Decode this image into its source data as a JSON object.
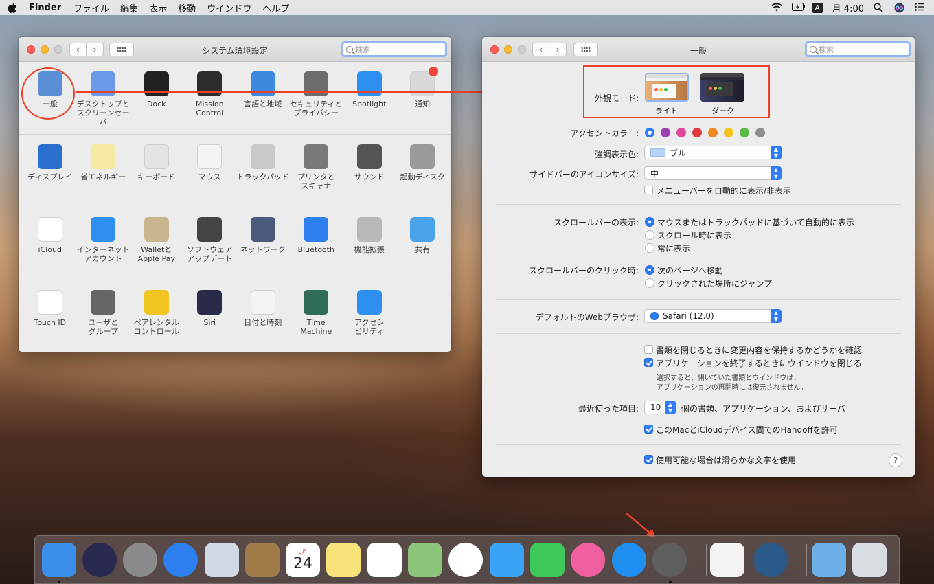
{
  "menubar": {
    "app": "Finder",
    "items": [
      "ファイル",
      "編集",
      "表示",
      "移動",
      "ウインドウ",
      "ヘルプ"
    ],
    "ime": "A",
    "clock": "月 4:00"
  },
  "prefs_window": {
    "title": "システム環境設定",
    "search_placeholder": "検索",
    "rows": [
      [
        {
          "label": "一般",
          "icon": "general-icon",
          "color": "#5a8fd6"
        },
        {
          "label": "デスクトップと\nスクリーンセーバ",
          "icon": "desktop-icon",
          "color": "#6a9ae8"
        },
        {
          "label": "Dock",
          "icon": "dock-icon",
          "color": "#222222"
        },
        {
          "label": "Mission\nControl",
          "icon": "mission-control-icon",
          "color": "#2c2c2c"
        },
        {
          "label": "言語と地域",
          "icon": "language-icon",
          "color": "#3c8ae0"
        },
        {
          "label": "セキュリティと\nプライバシー",
          "icon": "security-icon",
          "color": "#6c6c6c"
        },
        {
          "label": "Spotlight",
          "icon": "spotlight-icon",
          "color": "#2d8ff0"
        },
        {
          "label": "通知",
          "icon": "notifications-icon",
          "color": "#d8d8d8"
        }
      ],
      [
        {
          "label": "ディスプレイ",
          "icon": "display-icon",
          "color": "#2a6fcf"
        },
        {
          "label": "省エネルギー",
          "icon": "energy-icon",
          "color": "#f6e9a0"
        },
        {
          "label": "キーボード",
          "icon": "keyboard-icon",
          "color": "#e4e4e4"
        },
        {
          "label": "マウス",
          "icon": "mouse-icon",
          "color": "#f4f4f4"
        },
        {
          "label": "トラックパッド",
          "icon": "trackpad-icon",
          "color": "#c8c8c8"
        },
        {
          "label": "プリンタと\nスキャナ",
          "icon": "printer-icon",
          "color": "#7a7a7a"
        },
        {
          "label": "サウンド",
          "icon": "sound-icon",
          "color": "#555555"
        },
        {
          "label": "起動ディスク",
          "icon": "startup-disk-icon",
          "color": "#9a9a9a"
        }
      ],
      [
        {
          "label": "iCloud",
          "icon": "icloud-icon",
          "color": "#ffffff"
        },
        {
          "label": "インターネット\nアカウント",
          "icon": "internet-accounts-icon",
          "color": "#2d8ff0"
        },
        {
          "label": "Walletと\nApple Pay",
          "icon": "wallet-icon",
          "color": "#c9b68e"
        },
        {
          "label": "ソフトウェア\nアップデート",
          "icon": "software-update-icon",
          "color": "#444444"
        },
        {
          "label": "ネットワーク",
          "icon": "network-icon",
          "color": "#4a5a7a"
        },
        {
          "label": "Bluetooth",
          "icon": "bluetooth-icon",
          "color": "#2d7ff0"
        },
        {
          "label": "機能拡張",
          "icon": "extensions-icon",
          "color": "#b8b8b8"
        },
        {
          "label": "共有",
          "icon": "sharing-icon",
          "color": "#4aa3e8"
        }
      ],
      [
        {
          "label": "Touch ID",
          "icon": "touch-id-icon",
          "color": "#ffffff"
        },
        {
          "label": "ユーザと\nグループ",
          "icon": "users-icon",
          "color": "#666666"
        },
        {
          "label": "ペアレンタル\nコントロール",
          "icon": "parental-controls-icon",
          "color": "#f0c520"
        },
        {
          "label": "Siri",
          "icon": "siri-icon",
          "color": "#2a2a4a"
        },
        {
          "label": "日付と時刻",
          "icon": "date-time-icon",
          "color": "#f4f4f4"
        },
        {
          "label": "Time\nMachine",
          "icon": "time-machine-icon",
          "color": "#2f6d5a"
        },
        {
          "label": "アクセシ\nビリティ",
          "icon": "accessibility-icon",
          "color": "#2d8ff0"
        }
      ]
    ]
  },
  "general_window": {
    "title": "一般",
    "search_placeholder": "検索",
    "appearance": {
      "label": "外観モード:",
      "light": "ライト",
      "dark": "ダーク"
    },
    "accent": {
      "label": "アクセントカラー:",
      "colors": [
        "#2f7cf6",
        "#9b3fb5",
        "#e2479b",
        "#e0393e",
        "#f08a24",
        "#f4c31c",
        "#5cb946",
        "#8e8e8e"
      ]
    },
    "highlight": {
      "label": "強調表示色:",
      "value": "ブルー",
      "swatch": "#b5d3f7"
    },
    "sidebar": {
      "label": "サイドバーのアイコンサイズ:",
      "value": "中"
    },
    "autohide_menubar": "メニューバーを自動的に表示/非表示",
    "scrollbar_show": {
      "label": "スクロールバーの表示:",
      "options": [
        "マウスまたはトラックパッドに基づいて自動的に表示",
        "スクロール時に表示",
        "常に表示"
      ]
    },
    "scrollbar_click": {
      "label": "スクロールバーのクリック時:",
      "options": [
        "次のページへ移動",
        "クリックされた場所にジャンプ"
      ]
    },
    "browser": {
      "label": "デフォルトのWebブラウザ:",
      "value": "Safari (12.0)"
    },
    "ask_keep_changes": "書類を閉じるときに変更内容を保持するかどうかを確認",
    "close_windows": "アプリケーションを終了するときにウインドウを閉じる",
    "close_windows_note1": "選択すると、開いていた書類とウインドウは、",
    "close_windows_note2": "アプリケーションの再開時には復元されません。",
    "recent": {
      "label": "最近使った項目:",
      "value": "10",
      "suffix": "個の書類、アプリケーション、およびサーバ"
    },
    "handoff": "このMacとiCloudデバイス間でのHandoffを許可",
    "smooth_fonts": "使用可能な場合は滑らかな文字を使用",
    "help": "?"
  },
  "dock": {
    "calendar_month": "9月",
    "calendar_day": "24",
    "items": [
      {
        "name": "finder-icon",
        "color": "#3b8eea"
      },
      {
        "name": "siri-icon",
        "color": "#2a2a50"
      },
      {
        "name": "launchpad-icon",
        "color": "#8a8a8a"
      },
      {
        "name": "safari-icon",
        "color": "#2d7ff0"
      },
      {
        "name": "mail-icon",
        "color": "#cfd8e4"
      },
      {
        "name": "contacts-icon",
        "color": "#a07a48"
      },
      {
        "name": "calendar-icon",
        "color": "#ffffff"
      },
      {
        "name": "notes-icon",
        "color": "#f8e27a"
      },
      {
        "name": "reminders-icon",
        "color": "#ffffff"
      },
      {
        "name": "maps-icon",
        "color": "#8cc47a"
      },
      {
        "name": "photos-icon",
        "color": "#ffffff"
      },
      {
        "name": "messages-icon",
        "color": "#3aa3f5"
      },
      {
        "name": "facetime-icon",
        "color": "#3ec85a"
      },
      {
        "name": "itunes-icon",
        "color": "#f25fa0"
      },
      {
        "name": "app-store-icon",
        "color": "#1e8ff0"
      },
      {
        "name": "system-preferences-icon",
        "color": "#5e5e5e"
      },
      {
        "name": "textedit-icon",
        "color": "#f4f4f4"
      },
      {
        "name": "quicktime-icon",
        "color": "#2a5a8a"
      },
      {
        "name": "downloads-icon",
        "color": "#6cb0e8"
      },
      {
        "name": "trash-icon",
        "color": "#d8dde2"
      }
    ]
  }
}
